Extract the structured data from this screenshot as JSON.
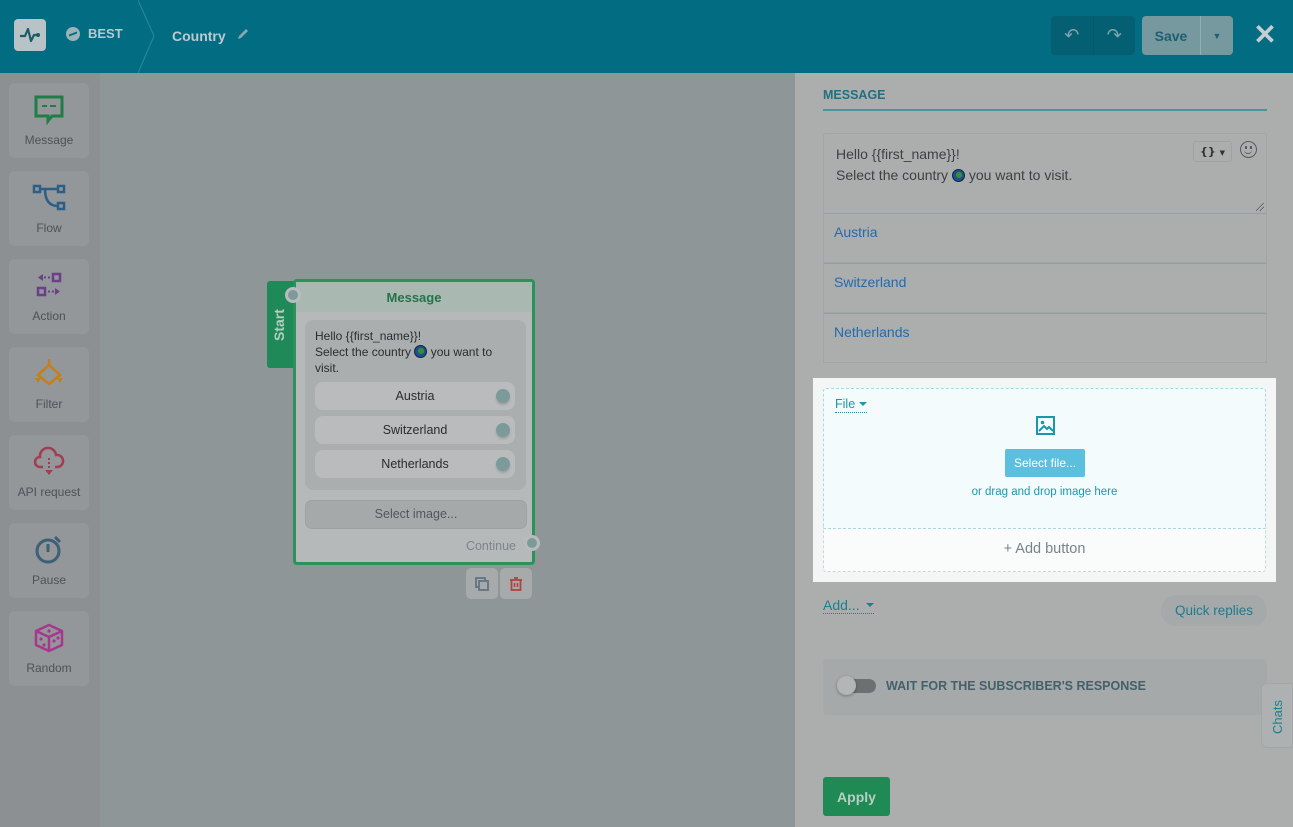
{
  "header": {
    "bot_name": "BEST",
    "page_name": "Country",
    "save_label": "Save",
    "icons": {
      "logo": "pulse-logo-icon",
      "messenger": "messenger-icon",
      "edit": "pencil-icon",
      "undo": "undo-icon",
      "redo": "redo-icon",
      "close": "close-icon"
    }
  },
  "palette": {
    "items": [
      {
        "label": "Message",
        "icon": "message-icon",
        "color": "#1f8a4c"
      },
      {
        "label": "Flow",
        "icon": "flow-icon",
        "color": "#2c5f86"
      },
      {
        "label": "Action",
        "icon": "action-icon",
        "color": "#6b3f8a"
      },
      {
        "label": "Filter",
        "icon": "filter-icon",
        "color": "#c47f1a"
      },
      {
        "label": "API request",
        "icon": "api-request-icon",
        "color": "#a33d52"
      },
      {
        "label": "Pause",
        "icon": "pause-timer-icon",
        "color": "#3d5f78"
      },
      {
        "label": "Random",
        "icon": "dice-icon",
        "color": "#a6378e"
      }
    ]
  },
  "node": {
    "start_label": "Start",
    "title": "Message",
    "text_line1": "Hello {{first_name}}!",
    "text_line2_before": "Select the country",
    "text_line2_after": "you want to",
    "text_line3": "visit.",
    "buttons": [
      "Austria",
      "Switzerland",
      "Netherlands"
    ],
    "select_image_label": "Select image...",
    "continue_label": "Continue"
  },
  "panel": {
    "section_title": "MESSAGE",
    "message_line1": "Hello {{first_name}}!",
    "message_line2_before": "Select the country",
    "message_line2_after": "you want to visit.",
    "variable_button": "{}",
    "buttons": [
      "Austria",
      "Switzerland",
      "Netherlands"
    ],
    "file_dropdown": "File",
    "select_file_label": "Select file...",
    "drop_hint": "or drag and drop image here",
    "add_button_label": "+ Add button",
    "add_dropdown": "Add...",
    "quick_replies_label": "Quick replies",
    "wait_label": "WAIT FOR THE SUBSCRIBER'S RESPONSE",
    "wait_enabled": false,
    "apply_label": "Apply"
  },
  "chats_tab": "Chats",
  "colors": {
    "topbar": "#026d82",
    "accent_green": "#208a55",
    "link_blue": "#226aaf",
    "upload_blue": "#5bc0de"
  }
}
